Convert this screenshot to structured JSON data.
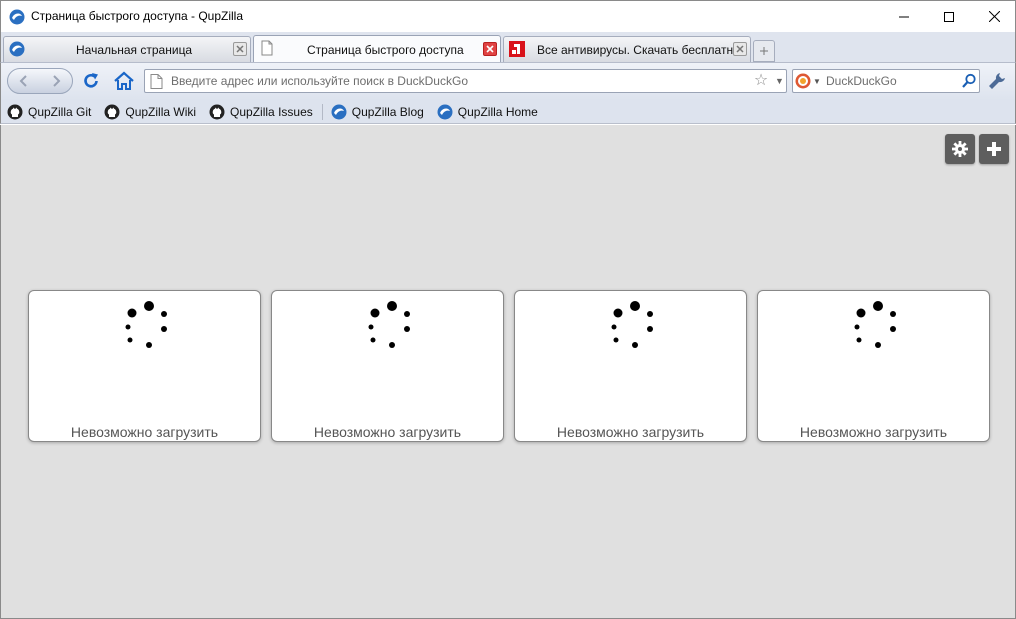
{
  "window": {
    "title": "Страница быстрого доступа - QupZilla"
  },
  "tabs": [
    {
      "label": "Начальная страница",
      "active": false,
      "icon": "qupzilla-icon"
    },
    {
      "label": "Страница быстрого доступа",
      "active": true,
      "icon": "page-icon"
    },
    {
      "label": "Все антивирусы. Скачать бесплатно",
      "active": false,
      "icon": "site-favicon"
    }
  ],
  "toolbar": {
    "url_placeholder": "Введите адрес или используйте поиск в DuckDuckGo",
    "search_placeholder": "DuckDuckGo"
  },
  "bookmarks": [
    {
      "label": "QupZilla Git",
      "icon": "github-icon"
    },
    {
      "label": "QupZilla Wiki",
      "icon": "github-icon"
    },
    {
      "label": "QupZilla Issues",
      "icon": "github-icon"
    },
    {
      "label": "QupZilla Blog",
      "icon": "qupzilla-icon"
    },
    {
      "label": "QupZilla Home",
      "icon": "qupzilla-icon"
    }
  ],
  "speed_dial": {
    "tiles": [
      {
        "label": "Невозможно загрузить"
      },
      {
        "label": "Невозможно загрузить"
      },
      {
        "label": "Невозможно загрузить"
      },
      {
        "label": "Невозможно загрузить"
      }
    ]
  },
  "colors": {
    "content_background": "#e0e0e0",
    "tab_close_active": "#e04343",
    "nav_accent": "#1a66c8"
  }
}
